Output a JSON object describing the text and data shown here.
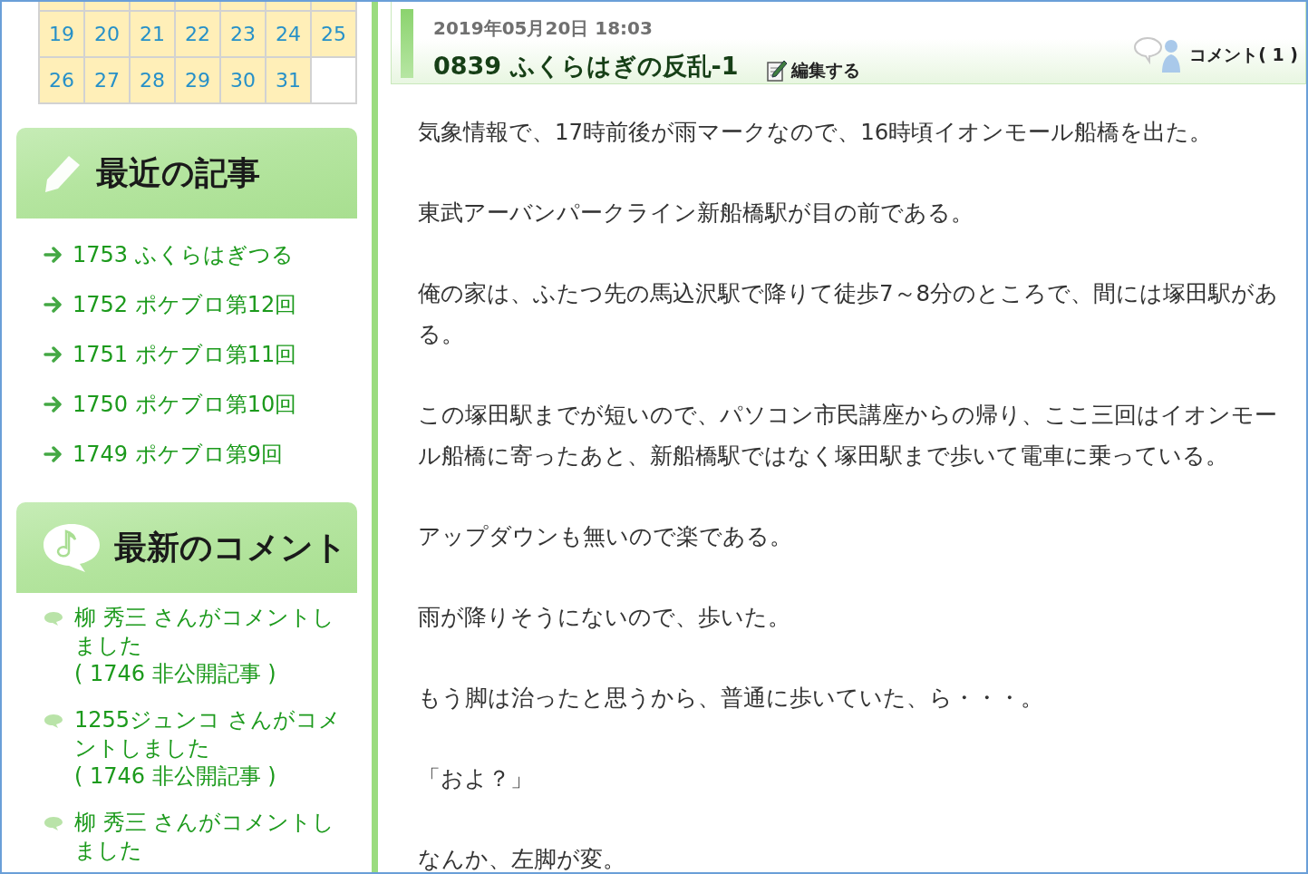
{
  "calendar": {
    "rows": [
      [
        "19",
        "20",
        "21",
        "22",
        "23",
        "24",
        "25"
      ],
      [
        "26",
        "27",
        "28",
        "29",
        "30",
        "31"
      ]
    ]
  },
  "sidebar": {
    "sections": [
      {
        "kind": "articles",
        "heading": "最近の記事",
        "items": [
          {
            "text": "1753 ふくらはぎつる"
          },
          {
            "text": "1752 ポケブロ第12回"
          },
          {
            "text": "1751 ポケブロ第11回"
          },
          {
            "text": "1750 ポケブロ第10回"
          },
          {
            "text": "1749 ポケブロ第9回"
          }
        ]
      },
      {
        "kind": "comments",
        "heading": "最新のコメント",
        "items": [
          {
            "text": "柳 秀三 さんがコメントしました",
            "article": "( 1746 非公開記事 )"
          },
          {
            "text": "1255ジュンコ さんがコメントしました",
            "article": "( 1746 非公開記事 )"
          },
          {
            "text": "柳 秀三 さんがコメントしました"
          }
        ]
      }
    ]
  },
  "entry": {
    "date": "2019年05月20日 18:03",
    "title": "0839 ふくらはぎの反乱-1",
    "edit": "編集する",
    "comments": "コメント( 1 )",
    "paragraphs": [
      "気象情報で、17時前後が雨マークなので、16時頃イオンモール船橋を出た。",
      "東武アーバンパークライン新船橋駅が目の前である。",
      "俺の家は、ふたつ先の馬込沢駅で降りて徒歩7～8分のところで、間には塚田駅がある。",
      "この塚田駅までが短いので、パソコン市民講座からの帰り、ここ三回はイオンモール船橋に寄ったあと、新船橋駅ではなく塚田駅まで歩いて電車に乗っている。",
      "アップダウンも無いので楽である。",
      "雨が降りそうにないので、歩いた。",
      "もう脚は治ったと思うから、普通に歩いていた、ら・・・。",
      "「およ？」",
      "なんか、左脚が変。"
    ]
  }
}
